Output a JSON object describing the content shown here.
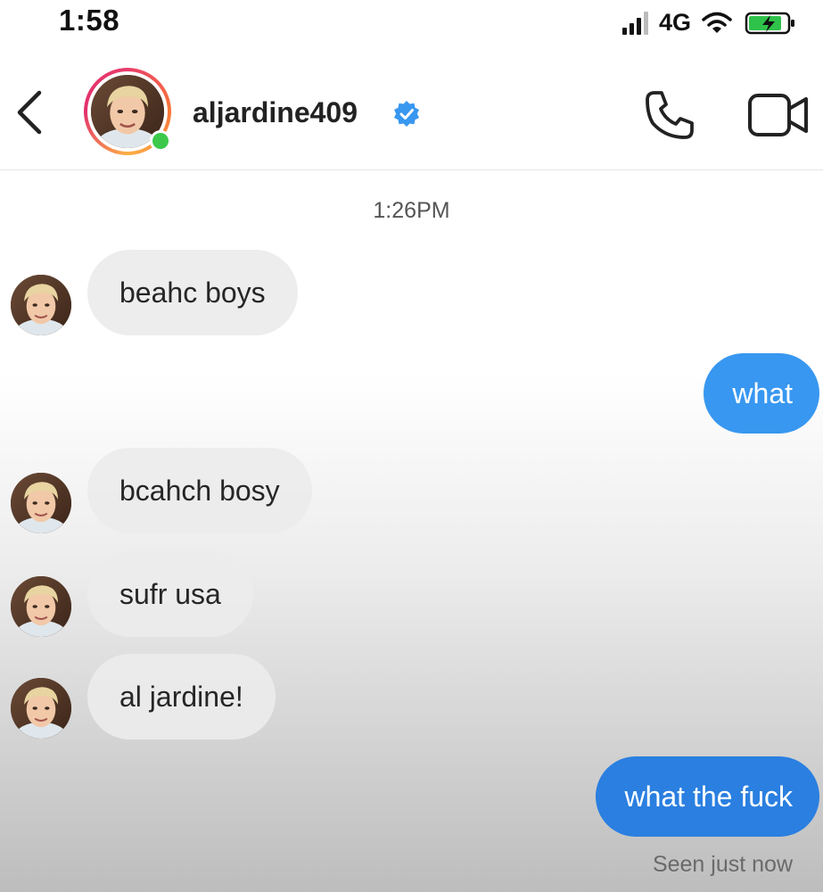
{
  "status_bar": {
    "time": "1:58",
    "network": "4G",
    "icons": [
      "signal-icon",
      "wifi-icon",
      "battery-charging-icon"
    ]
  },
  "header": {
    "username": "aljardine409",
    "verified": true,
    "online": true,
    "icons": [
      "back-arrow-icon",
      "phone-icon",
      "video-camera-icon"
    ]
  },
  "conversation": {
    "timestamp": "1:26PM",
    "messages": [
      {
        "from": "them",
        "text": "beahc boys"
      },
      {
        "from": "me",
        "text": "what"
      },
      {
        "from": "them",
        "text": "bcahch bosy"
      },
      {
        "from": "them",
        "text": "sufr usa"
      },
      {
        "from": "them",
        "text": "al jardine!"
      },
      {
        "from": "me",
        "text": "what the fuck"
      }
    ],
    "seen_status": "Seen just now"
  },
  "colors": {
    "outgoing_bubble": "#3897f0",
    "incoming_bubble": "#efefef",
    "online_dot": "#3cc94b",
    "verified_badge": "#3897f0"
  }
}
